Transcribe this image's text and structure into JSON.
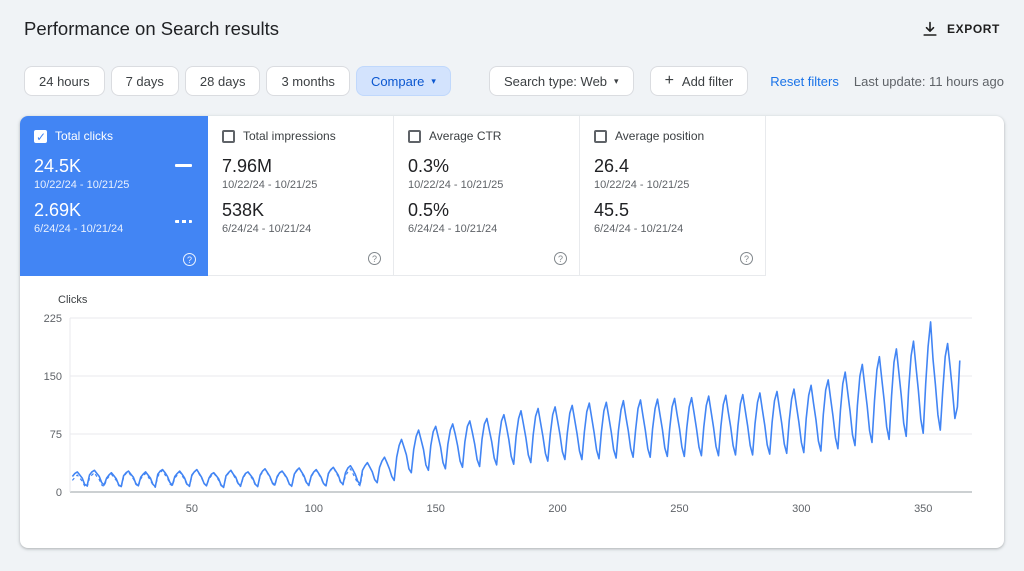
{
  "header": {
    "title": "Performance on Search results",
    "export_label": "EXPORT"
  },
  "filters": {
    "date_buttons": [
      "24 hours",
      "7 days",
      "28 days",
      "3 months"
    ],
    "compare_label": "Compare",
    "search_type_label": "Search type: Web",
    "add_filter_label": "Add filter",
    "reset_label": "Reset filters",
    "last_update": "Last update: 11 hours ago"
  },
  "icons": {
    "caret_down": "▾",
    "plus": "+",
    "help": "?"
  },
  "metrics": [
    {
      "label": "Total clicks",
      "checked": true,
      "selected": true,
      "value1": "24.5K",
      "range1": "10/22/24 - 10/21/25",
      "value2": "2.69K",
      "range2": "6/24/24 - 10/21/24"
    },
    {
      "label": "Total impressions",
      "checked": false,
      "selected": false,
      "value1": "7.96M",
      "range1": "10/22/24 - 10/21/25",
      "value2": "538K",
      "range2": "6/24/24 - 10/21/24"
    },
    {
      "label": "Average CTR",
      "checked": false,
      "selected": false,
      "value1": "0.3%",
      "range1": "10/22/24 - 10/21/25",
      "value2": "0.5%",
      "range2": "6/24/24 - 10/21/24"
    },
    {
      "label": "Average position",
      "checked": false,
      "selected": false,
      "value1": "26.4",
      "range1": "10/22/24 - 10/21/25",
      "value2": "45.5",
      "range2": "6/24/24 - 10/21/24"
    }
  ],
  "chart_data": {
    "type": "line",
    "ylabel": "Clicks",
    "ylim": [
      0,
      225
    ],
    "xlim": [
      0,
      370
    ],
    "yticks": [
      0,
      75,
      150,
      225
    ],
    "xticks": [
      50,
      100,
      150,
      200,
      250,
      300,
      350
    ],
    "accent_color": "#4285f4",
    "legend_position": "none",
    "grid": "horizontal",
    "series": [
      {
        "name": "Total clicks 10/22/24 - 10/21/25",
        "style": "solid",
        "color": "#4285f4",
        "values": [
          20,
          24,
          26,
          22,
          18,
          10,
          8,
          22,
          26,
          28,
          24,
          20,
          12,
          9,
          18,
          22,
          25,
          21,
          17,
          9,
          7,
          21,
          25,
          27,
          23,
          19,
          11,
          8,
          19,
          23,
          26,
          22,
          18,
          10,
          7,
          23,
          27,
          29,
          25,
          20,
          12,
          9,
          20,
          24,
          27,
          23,
          18,
          10,
          8,
          22,
          26,
          29,
          24,
          19,
          11,
          8,
          18,
          23,
          25,
          21,
          17,
          9,
          6,
          21,
          25,
          28,
          23,
          19,
          11,
          8,
          19,
          24,
          26,
          22,
          18,
          10,
          7,
          22,
          27,
          30,
          25,
          20,
          12,
          9,
          20,
          25,
          27,
          23,
          18,
          10,
          8,
          23,
          28,
          31,
          26,
          21,
          12,
          9,
          21,
          26,
          29,
          24,
          19,
          11,
          8,
          24,
          29,
          32,
          27,
          22,
          13,
          10,
          25,
          31,
          34,
          29,
          23,
          14,
          10,
          28,
          34,
          38,
          32,
          26,
          16,
          12,
          32,
          40,
          45,
          38,
          30,
          20,
          15,
          45,
          60,
          68,
          58,
          48,
          30,
          25,
          55,
          72,
          80,
          68,
          55,
          35,
          28,
          60,
          78,
          85,
          72,
          58,
          38,
          30,
          62,
          80,
          88,
          75,
          60,
          40,
          32,
          65,
          85,
          92,
          78,
          62,
          42,
          33,
          68,
          88,
          95,
          80,
          65,
          44,
          35,
          70,
          92,
          100,
          85,
          68,
          46,
          36,
          72,
          95,
          105,
          88,
          70,
          48,
          38,
          74,
          98,
          108,
          90,
          72,
          50,
          40,
          75,
          100,
          110,
          92,
          74,
          52,
          42,
          76,
          102,
          112,
          94,
          75,
          53,
          42,
          78,
          104,
          115,
          96,
          77,
          54,
          43,
          78,
          105,
          116,
          97,
          78,
          55,
          44,
          80,
          106,
          118,
          98,
          79,
          56,
          45,
          80,
          108,
          119,
          99,
          80,
          56,
          45,
          82,
          108,
          120,
          100,
          81,
          57,
          46,
          82,
          110,
          121,
          101,
          82,
          58,
          46,
          83,
          110,
          122,
          102,
          82,
          58,
          47,
          84,
          112,
          124,
          103,
          83,
          59,
          47,
          85,
          113,
          125,
          104,
          84,
          60,
          48,
          86,
          114,
          126,
          105,
          85,
          60,
          48,
          88,
          116,
          128,
          107,
          86,
          61,
          49,
          90,
          118,
          130,
          109,
          88,
          62,
          50,
          92,
          120,
          133,
          111,
          90,
          64,
          51,
          95,
          125,
          138,
          115,
          93,
          66,
          53,
          100,
          132,
          145,
          121,
          98,
          70,
          56,
          105,
          140,
          155,
          129,
          104,
          74,
          60,
          112,
          150,
          165,
          138,
          111,
          79,
          64,
          118,
          158,
          175,
          146,
          118,
          84,
          68,
          125,
          168,
          185,
          154,
          124,
          89,
          72,
          132,
          176,
          195,
          163,
          131,
          94,
          76,
          140,
          188,
          220,
          172,
          139,
          100,
          80,
          130,
          175,
          192,
          162,
          130,
          95,
          110,
          170
        ]
      },
      {
        "name": "Total clicks 6/24/24 - 10/21/24",
        "style": "dashed",
        "color": "#4285f4",
        "values": [
          15,
          19,
          22,
          18,
          14,
          8,
          6,
          18,
          22,
          25,
          20,
          16,
          9,
          7,
          16,
          20,
          23,
          19,
          15,
          8,
          6,
          19,
          24,
          26,
          21,
          17,
          10,
          7,
          17,
          21,
          24,
          20,
          15,
          9,
          6,
          20,
          25,
          28,
          22,
          18,
          10,
          8,
          18,
          22,
          26,
          21,
          16,
          9,
          7,
          21,
          26,
          29,
          23,
          18,
          11,
          8,
          17,
          21,
          24,
          20,
          15,
          8,
          6,
          20,
          24,
          28,
          22,
          17,
          10,
          7,
          18,
          23,
          26,
          21,
          16,
          9,
          7,
          21,
          26,
          30,
          24,
          19,
          11,
          8,
          19,
          24,
          27,
          22,
          17,
          10,
          7,
          22,
          27,
          31,
          25,
          19,
          11,
          8,
          20,
          25,
          28,
          23,
          18,
          10,
          8,
          23,
          28,
          32,
          26,
          20,
          12,
          9,
          21,
          26,
          30,
          24,
          18,
          11,
          8,
          24
        ]
      }
    ]
  }
}
